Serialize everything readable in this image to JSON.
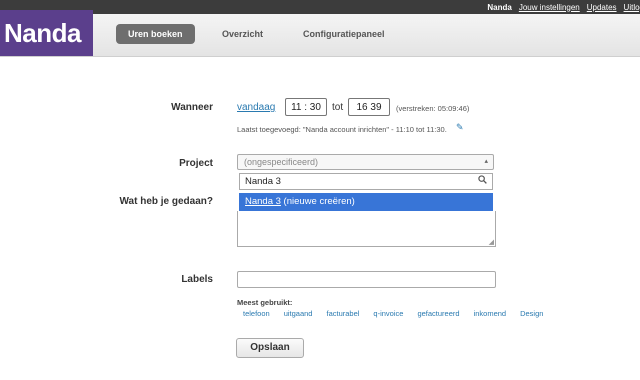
{
  "topbar": {
    "user": "Nanda",
    "links": [
      "Jouw instellingen",
      "Updates",
      "Uitlog"
    ]
  },
  "brand": {
    "logo": "Nanda",
    "color": "#5b3f8c"
  },
  "nav": {
    "tabs": [
      {
        "label": "Uren boeken",
        "active": true
      },
      {
        "label": "Overzicht",
        "active": false
      },
      {
        "label": "Configuratiepaneel",
        "active": false
      }
    ]
  },
  "form": {
    "when": {
      "label": "Wanneer",
      "date_link": "vandaag",
      "start": "11 : 30",
      "to": "tot",
      "end": "16  39",
      "elapsed": "(verstreken: 05:09:46)",
      "last_added": "Laatst toegevoegd: \"Nanda account inrichten\" - 11:10 tot 11:30."
    },
    "project": {
      "label": "Project",
      "selected": "(ongespecificeerd)",
      "search_value": "Nanda 3",
      "option_prefix": "Nanda 3",
      "option_suffix": " (nieuwe creëren)"
    },
    "what": {
      "label": "Wat heb je gedaan?"
    },
    "labels": {
      "label": "Labels",
      "most_used_title": "Meest gebruikt:",
      "tags": [
        "telefoon",
        "uitgaand",
        "facturabel",
        "q-invoice",
        "gefactureerd",
        "inkomend",
        "Design"
      ]
    },
    "save_label": "Opslaan"
  },
  "icons": {
    "dropdown": "triangle-up-down",
    "search": "magnifier",
    "edit": "pencil",
    "resize": "resize-grip"
  }
}
